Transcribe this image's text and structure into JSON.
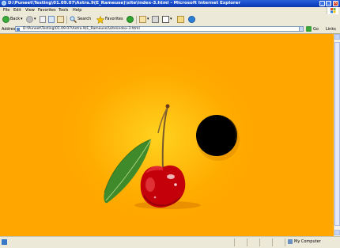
{
  "window": {
    "title": "D:\\Puneet\\Testing\\01.09.07\\Astra.9(E_Rameuse)\\site\\index-3.html - Microsoft Internet Explorer"
  },
  "menu": {
    "items": [
      "File",
      "Edit",
      "View",
      "Favorites",
      "Tools",
      "Help"
    ]
  },
  "toolbar": {
    "back_label": "Back",
    "search_label": "Search",
    "favorites_label": "Favorites"
  },
  "address": {
    "label": "Address",
    "value": "D:\\Puneet\\Testing\\01.09.07\\Astra.9(E_Rameuse)\\site\\index-3.html",
    "go_label": "Go",
    "links_label": "Links"
  },
  "status": {
    "zone_label": "My Computer"
  },
  "colors": {
    "background": "#ffa600",
    "background_glow": "#ffd21f",
    "cherry": "#c4000a",
    "leaf": "#3f8a2a",
    "hole": "#000000"
  }
}
